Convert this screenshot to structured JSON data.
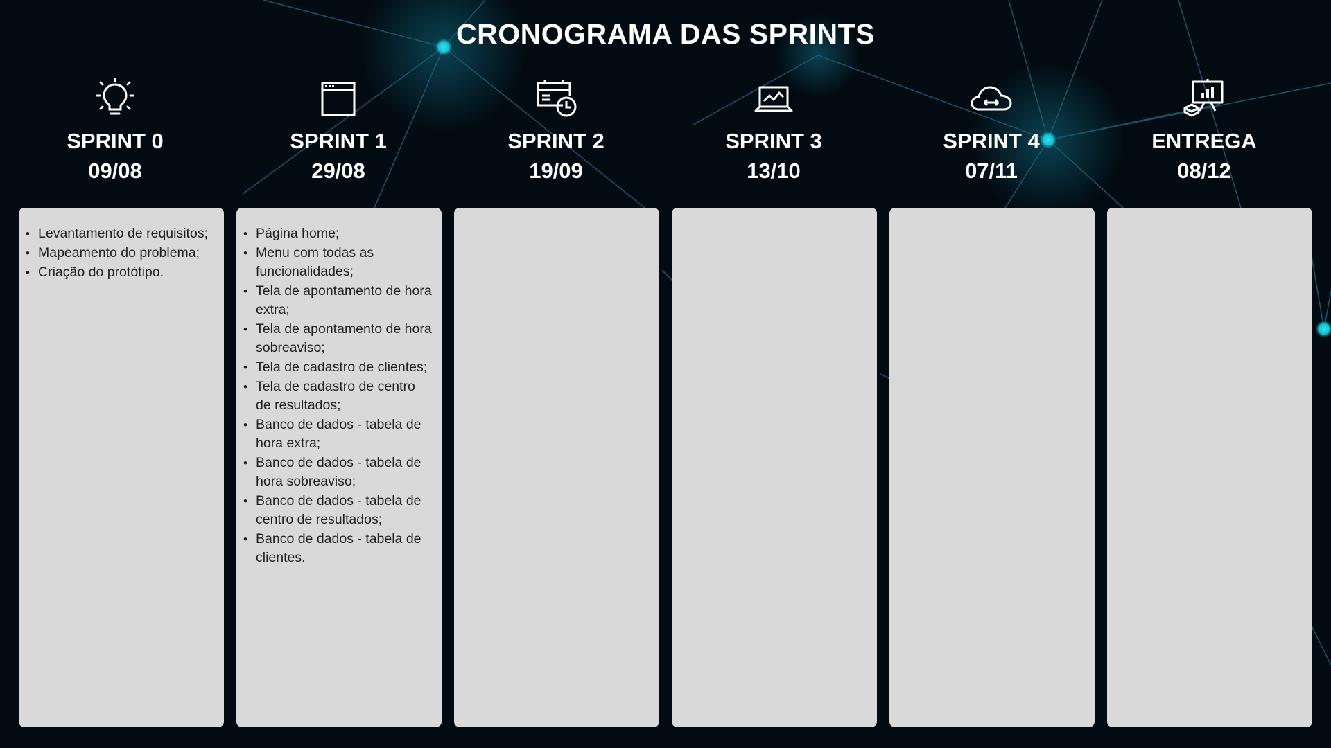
{
  "title": "CRONOGRAMA DAS SPRINTS",
  "accent_color": "#13c4d8",
  "columns": [
    {
      "icon": "lightbulb-icon",
      "name": "SPRINT 0",
      "date": "09/08",
      "items": [
        "Levantamento de requisitos;",
        "Mapeamento do problema;",
        "Criação do protótipo."
      ]
    },
    {
      "icon": "browser-window-icon",
      "name": "SPRINT 1",
      "date": "29/08",
      "items": [
        "Página home;",
        "Menu com todas as funcionalidades;",
        "Tela de apontamento de hora extra;",
        "Tela de apontamento de hora sobreaviso;",
        "Tela de cadastro de clientes;",
        "Tela de cadastro de centro de resultados;",
        "Banco de dados - tabela de hora extra;",
        "Banco de dados - tabela de hora sobreaviso;",
        "Banco de dados - tabela de centro de resultados;",
        "Banco de dados - tabela de clientes."
      ]
    },
    {
      "icon": "calendar-clock-icon",
      "name": "SPRINT 2",
      "date": "19/09",
      "items": []
    },
    {
      "icon": "laptop-chart-icon",
      "name": "SPRINT 3",
      "date": "13/10",
      "items": []
    },
    {
      "icon": "cloud-sync-icon",
      "name": "SPRINT 4",
      "date": "07/11",
      "items": []
    },
    {
      "icon": "presentation-board-icon",
      "name": "ENTREGA",
      "date": "08/12",
      "items": []
    }
  ]
}
